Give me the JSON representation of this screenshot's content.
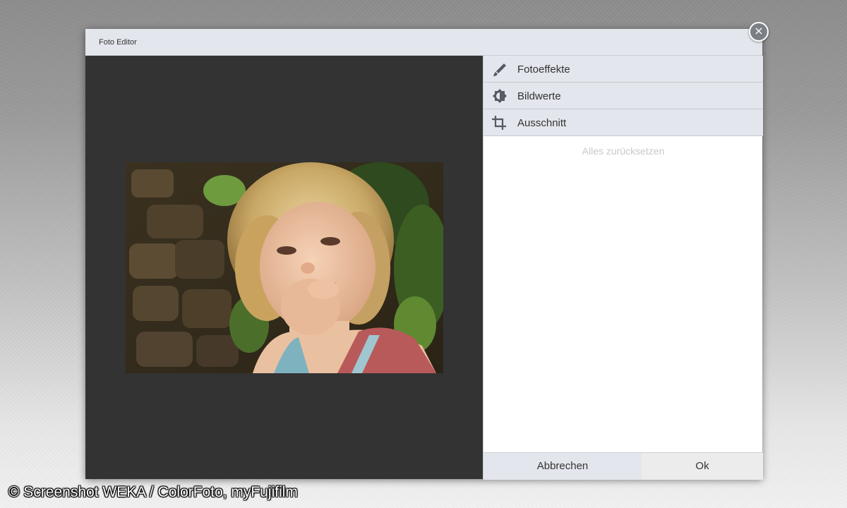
{
  "window": {
    "title": "Foto Editor",
    "close_icon": "close-icon"
  },
  "photo": {
    "subject": "portrait-photo"
  },
  "side_panel": {
    "menu": [
      {
        "label": "Fotoeffekte",
        "icon": "brush-icon"
      },
      {
        "label": "Bildwerte",
        "icon": "brightness-icon"
      },
      {
        "label": "Ausschnitt",
        "icon": "crop-icon"
      }
    ],
    "reset_label": "Alles zurücksetzen"
  },
  "footer": {
    "cancel_label": "Abbrechen",
    "ok_label": "Ok"
  },
  "credit": "© Screenshot WEKA / ColorFoto, myFujifilm",
  "colors": {
    "canvas_background": "#333333",
    "menu_background": "#e3e6ec",
    "reset_text": "#c8c8c8"
  }
}
